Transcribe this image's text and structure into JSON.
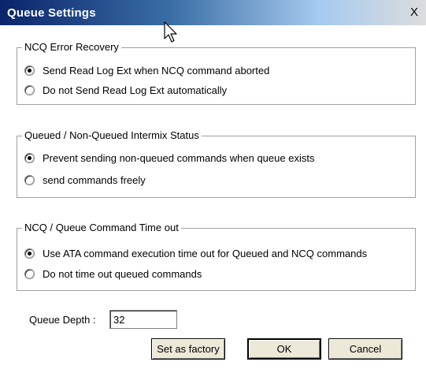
{
  "window": {
    "title": "Queue Settings",
    "close_label": "X"
  },
  "groups": [
    {
      "label": "NCQ Error Recovery",
      "options": [
        {
          "label": "Send Read Log Ext when NCQ command aborted",
          "checked": true
        },
        {
          "label": "Do not Send Read Log Ext automatically",
          "checked": false
        }
      ]
    },
    {
      "label": "Queued / Non-Queued Intermix Status",
      "options": [
        {
          "label": "Prevent sending non-queued commands when queue exists",
          "checked": true
        },
        {
          "label": "send commands freely",
          "checked": false
        }
      ]
    },
    {
      "label": "NCQ / Queue Command Time out",
      "options": [
        {
          "label": "Use ATA command execution time out for Queued and NCQ commands",
          "checked": true
        },
        {
          "label": "Do not time out queued commands",
          "checked": false
        }
      ]
    }
  ],
  "queue_depth": {
    "label": "Queue Depth :",
    "value": "32"
  },
  "buttons": {
    "factory": "Set as factory",
    "ok": "OK",
    "cancel": "Cancel"
  }
}
